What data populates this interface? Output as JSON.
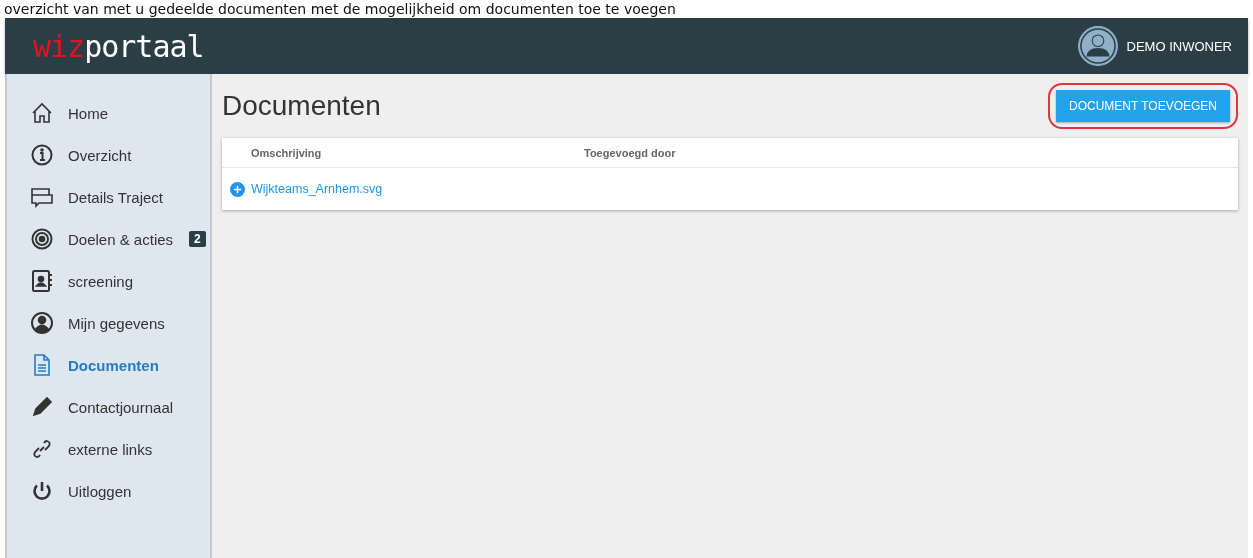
{
  "caption": "overzicht van met u gedeelde documenten met de mogelijkheid om documenten toe te voegen",
  "header": {
    "logo_accent": "wiz",
    "logo_rest": "portaal",
    "user": "DEMO INWONER"
  },
  "sidebar": {
    "items": [
      {
        "label": "Home",
        "selected": false
      },
      {
        "label": "Overzicht",
        "selected": false
      },
      {
        "label": "Details Traject",
        "selected": false
      },
      {
        "label": "Doelen & acties",
        "selected": false,
        "badge": "2"
      },
      {
        "label": "screening",
        "selected": false
      },
      {
        "label": "Mijn gegevens",
        "selected": false
      },
      {
        "label": "Documenten",
        "selected": true
      },
      {
        "label": "Contactjournaal",
        "selected": false
      },
      {
        "label": "externe links",
        "selected": false
      },
      {
        "label": "Uitloggen",
        "selected": false
      }
    ]
  },
  "page": {
    "title": "Documenten",
    "add_button": "DOCUMENT TOEVOEGEN"
  },
  "table": {
    "columns": [
      "Omschrijving",
      "Toegevoegd door"
    ],
    "rows": [
      {
        "name": "Wijkteams_Arnhem.svg"
      }
    ]
  }
}
